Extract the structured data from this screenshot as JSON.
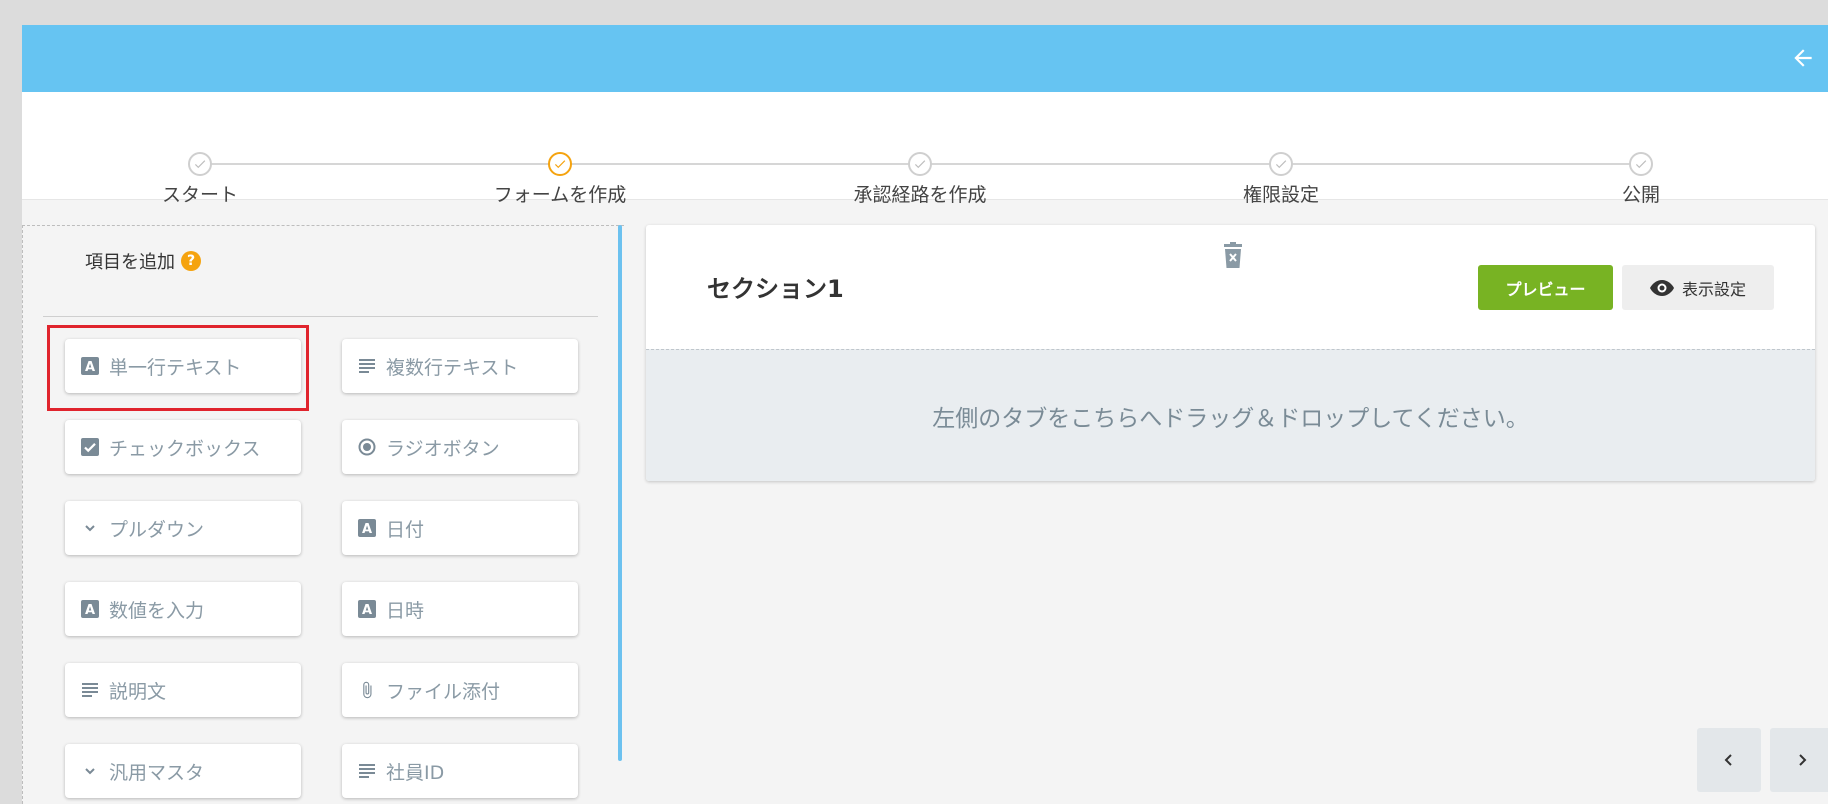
{
  "steps": [
    {
      "label": "スタート",
      "state": "done"
    },
    {
      "label": "フォームを作成",
      "state": "active"
    },
    {
      "label": "承認経路を作成",
      "state": "pending"
    },
    {
      "label": "権限設定",
      "state": "pending"
    },
    {
      "label": "公開",
      "state": "pending"
    }
  ],
  "left_panel": {
    "title": "項目を追加",
    "help": "?",
    "items": [
      {
        "label": "単一行テキスト",
        "icon": "letter-a-icon"
      },
      {
        "label": "複数行テキスト",
        "icon": "lines-icon"
      },
      {
        "label": "チェックボックス",
        "icon": "checkbox-icon"
      },
      {
        "label": "ラジオボタン",
        "icon": "radio-icon"
      },
      {
        "label": "プルダウン",
        "icon": "chevron-down-icon"
      },
      {
        "label": "日付",
        "icon": "letter-a-icon"
      },
      {
        "label": "数値を入力",
        "icon": "letter-a-icon"
      },
      {
        "label": "日時",
        "icon": "letter-a-icon"
      },
      {
        "label": "説明文",
        "icon": "lines-icon"
      },
      {
        "label": "ファイル添付",
        "icon": "paperclip-icon"
      },
      {
        "label": "汎用マスタ",
        "icon": "chevron-down-icon"
      },
      {
        "label": "社員ID",
        "icon": "lines-icon"
      }
    ]
  },
  "section": {
    "title": "セクション1",
    "preview_label": "プレビュー",
    "display_label": "表示設定",
    "drop_hint": "左側のタブをこちらへドラッグ＆ドロップしてください。"
  },
  "nav": {
    "prev": "‹",
    "next": "›"
  },
  "colors": {
    "header": "#66c4f2",
    "accent": "#f5a30f",
    "preview": "#78b323",
    "highlight": "#e0242d"
  }
}
